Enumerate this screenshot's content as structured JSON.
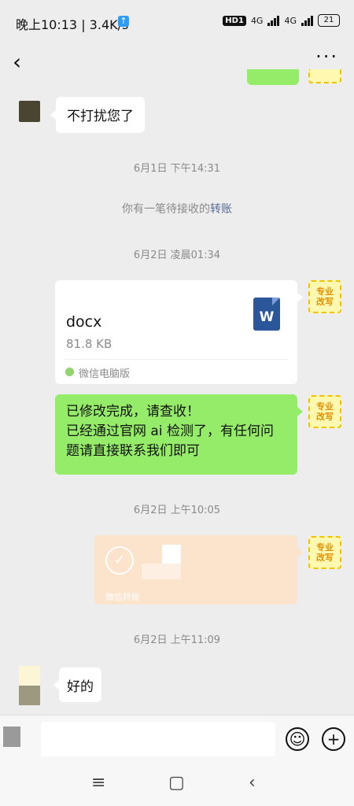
{
  "status_bar": {
    "time": "晚上10:13 | 3.4K/s",
    "hd": "HD1",
    "net1": "4G",
    "net2": "4G",
    "battery": "21"
  },
  "header": {
    "back": "‹",
    "more": "···"
  },
  "messages": {
    "m1": "不打扰您了",
    "t1": "6月1日 下午14:31",
    "notice_prefix": "你有一笔待接收的",
    "notice_link": "转账",
    "t2": "6月2日 凌晨01:34",
    "file": {
      "name": "docx",
      "size": "81.8 KB",
      "source": "微信电脑版",
      "icon_letter": "W"
    },
    "m2": "已修改完成，请查收！\n已经通过官网 ai 检测了，有任何问题请直接联系我们即可",
    "t3": "6月2日 上午10:05",
    "transfer": {
      "label": "微信转账",
      "check": "✓"
    },
    "t4": "6月2日 上午11:09",
    "m3": "好的"
  },
  "my_avatar": {
    "line1": "专业",
    "line2": "改写"
  },
  "input": {
    "emoji": "☺",
    "plus": "+"
  },
  "nav": {
    "menu": "≡",
    "home": "▢",
    "back": "‹"
  }
}
